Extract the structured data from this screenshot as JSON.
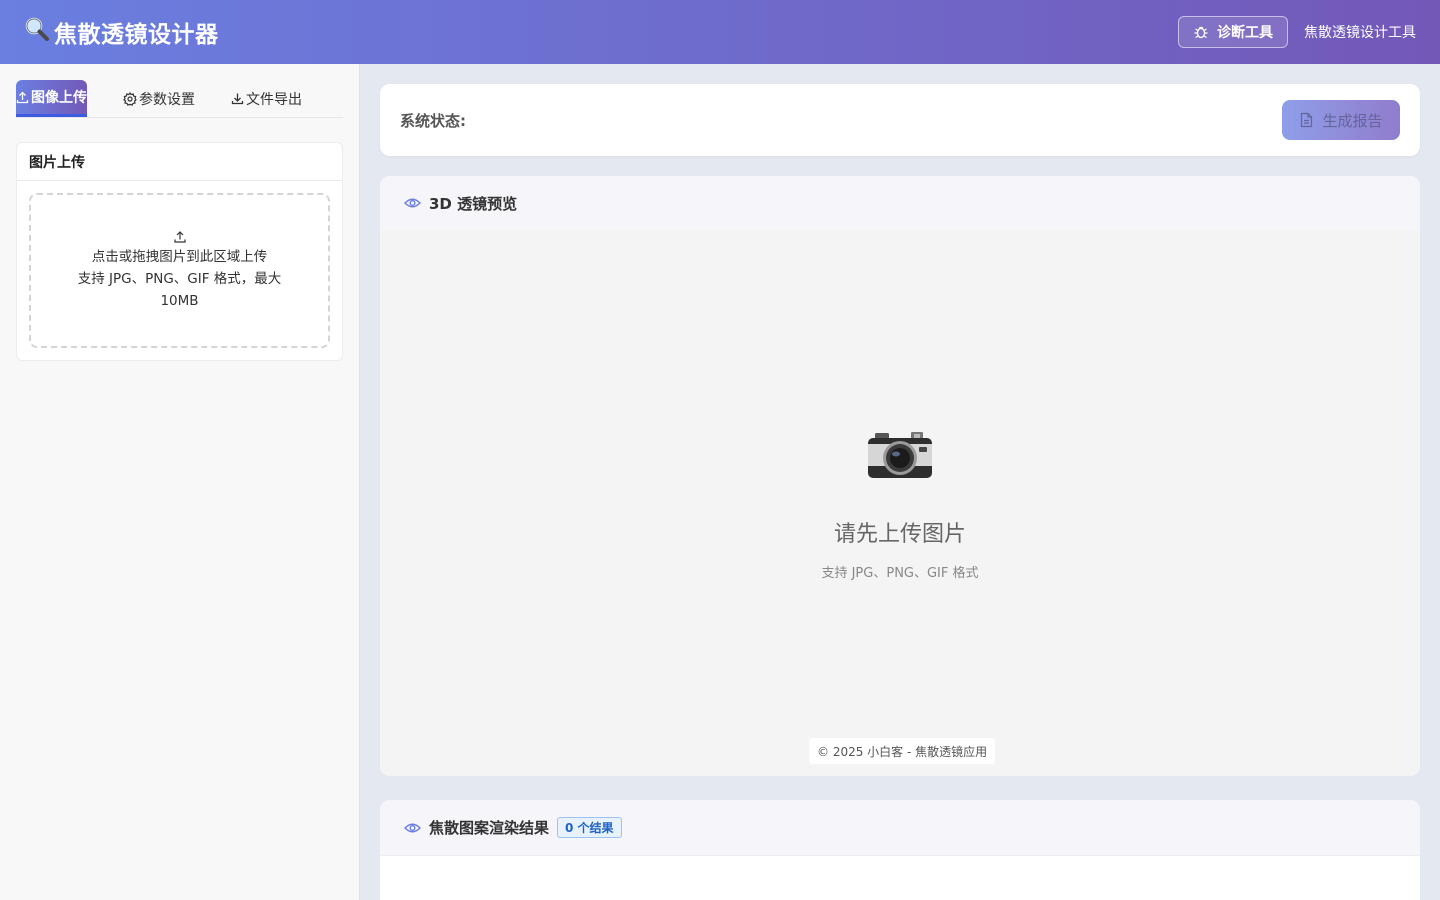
{
  "header": {
    "app_icon": "magnifier-icon",
    "title": "焦散透镜设计器",
    "diag_button": "诊断工具",
    "subtitle": "焦散透镜设计工具"
  },
  "sidebar": {
    "tabs": [
      {
        "label": "图像上传",
        "icon": "upload-icon",
        "active": true
      },
      {
        "label": "参数设置",
        "icon": "gear-icon",
        "active": false
      },
      {
        "label": "文件导出",
        "icon": "download-icon",
        "active": false
      }
    ],
    "upload_card": {
      "title": "图片上传",
      "hint_line1": "点击或拖拽图片到此区域上传",
      "hint_line2": "支持 JPG、PNG、GIF 格式，最大10MB"
    }
  },
  "status": {
    "label": "系统状态:",
    "report_button": "生成报告"
  },
  "preview": {
    "title": "3D 透镜预览",
    "empty_icon": "camera-icon",
    "empty_title": "请先上传图片",
    "empty_subtitle": "支持 JPG、PNG、GIF 格式",
    "copyright": "© 2025 小白客 - 焦散透镜应用"
  },
  "results": {
    "title": "焦散图案渲染结果",
    "badge": "0 个结果"
  },
  "colors": {
    "header_start": "#6a7fe0",
    "header_end": "#7358b8",
    "badge_text": "#1e63c7"
  }
}
